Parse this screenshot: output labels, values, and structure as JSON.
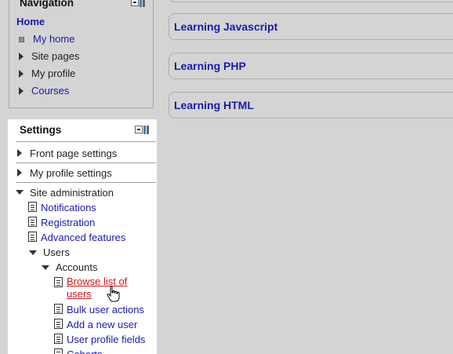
{
  "navigation": {
    "title": "Navigation",
    "home": "Home",
    "items": [
      {
        "label": "My home",
        "link": true
      },
      {
        "label": "Site pages",
        "link": false
      },
      {
        "label": "My profile",
        "link": false
      },
      {
        "label": "Courses",
        "link": true
      }
    ]
  },
  "settings": {
    "title": "Settings",
    "front_page": "Front page settings",
    "my_profile": "My profile settings",
    "site_admin": "Site administration",
    "admin_links": [
      "Notifications",
      "Registration",
      "Advanced features"
    ],
    "users": "Users",
    "accounts": "Accounts",
    "account_links": [
      "Browse list of users",
      "Bulk user actions",
      "Add a new user",
      "User profile fields",
      "Cohorts"
    ]
  },
  "courses": [
    "Learning Javascript",
    "Learning PHP",
    "Learning HTML"
  ],
  "colors": {
    "link": "#1b1ba8",
    "active_link": "#d0141a",
    "background": "#d4d4d4"
  }
}
